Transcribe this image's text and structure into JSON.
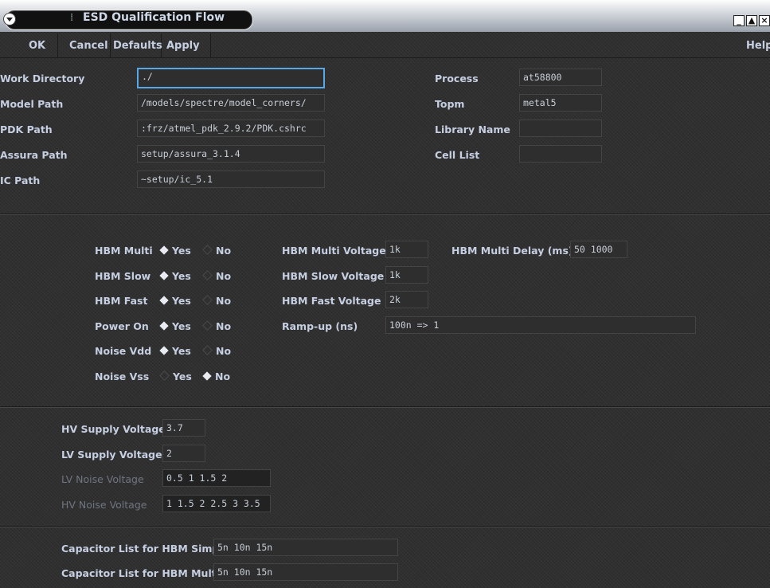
{
  "window": {
    "title": "ESD Qualification Flow",
    "buttons": {
      "minimize": "_",
      "maximize": "▲",
      "close": "×"
    }
  },
  "menu": {
    "ok": "OK",
    "cancel": "Cancel",
    "defaults": "Defaults",
    "apply": "Apply",
    "help": "Help"
  },
  "paths": {
    "work_directory": {
      "label": "Work Directory",
      "value": "./"
    },
    "model_path": {
      "label": "Model Path",
      "value": "/models/spectre/model_corners/"
    },
    "pdk_path": {
      "label": "PDK Path",
      "value": ":frz/atmel_pdk_2.9.2/PDK.cshrc"
    },
    "assura_path": {
      "label": "Assura Path",
      "value": "setup/assura_3.1.4"
    },
    "ic_path": {
      "label": "IC Path",
      "value": "~setup/ic_5.1"
    }
  },
  "right_fields": {
    "process": {
      "label": "Process",
      "value": "at58800"
    },
    "topm": {
      "label": "Topm",
      "value": "metal5"
    },
    "library_name": {
      "label": "Library Name",
      "value": ""
    },
    "cell_list": {
      "label": "Cell List",
      "value": ""
    }
  },
  "radio_common": {
    "yes": "Yes",
    "no": "No"
  },
  "tests": [
    {
      "label": "HBM Multi",
      "selected": "Yes"
    },
    {
      "label": "HBM Slow",
      "selected": "Yes"
    },
    {
      "label": "HBM Fast",
      "selected": "Yes"
    },
    {
      "label": "Power On",
      "selected": "Yes"
    },
    {
      "label": "Noise Vdd",
      "selected": "Yes"
    },
    {
      "label": "Noise Vss",
      "selected": "No"
    }
  ],
  "voltages": {
    "hbm_multi_voltage": {
      "label": "HBM Multi Voltage",
      "value": "1k"
    },
    "hbm_multi_delay": {
      "label": "HBM Multi Delay (ms)",
      "value": "50 1000"
    },
    "hbm_slow_voltage": {
      "label": "HBM Slow Voltage",
      "value": "1k"
    },
    "hbm_fast_voltage": {
      "label": "HBM Fast Voltage",
      "value": "2k"
    },
    "ramp_up": {
      "label": "Ramp-up (ns)",
      "value": "100n => 1"
    }
  },
  "supply": {
    "hv_supply_voltage": {
      "label": "HV Supply Voltage",
      "value": "3.7"
    },
    "lv_supply_voltage": {
      "label": "LV Supply Voltage",
      "value": "2"
    },
    "lv_noise_voltage": {
      "label": "LV Noise Voltage",
      "value": "0.5 1 1.5 2"
    },
    "hv_noise_voltage": {
      "label": "HV Noise Voltage",
      "value": "1 1.5 2 2.5 3 3.5"
    }
  },
  "capacitors": {
    "hbm_simple": {
      "label": "Capacitor List for HBM Simple",
      "value": "5n 10n 15n"
    },
    "hbm_multi": {
      "label": "Capacitor List for HBM Multi",
      "value": "5n 10n 15n"
    }
  },
  "colors": {
    "label": "#c6cfe2",
    "focus_border": "#58a8e8",
    "background": "#2f2f2f"
  }
}
